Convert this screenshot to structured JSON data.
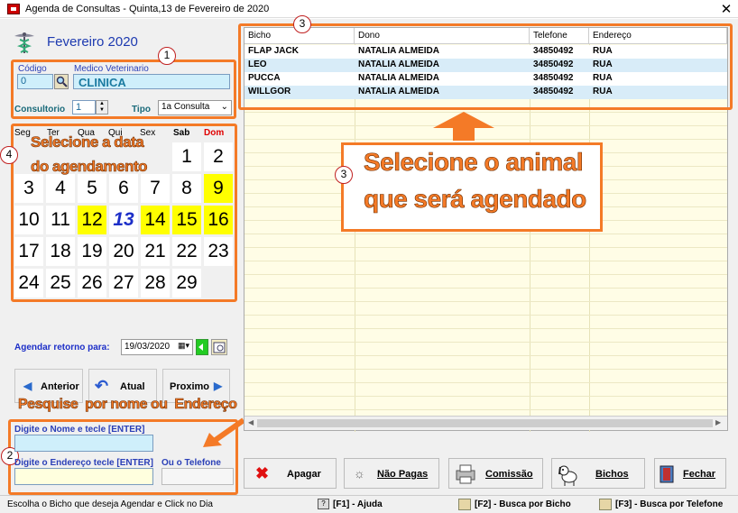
{
  "window": {
    "title": "Agenda de Consultas - Quinta,13 de Fevereiro de 2020",
    "close": "✕"
  },
  "calendar": {
    "month_title": "Fevereiro 2020",
    "weekdays": [
      "Seg",
      "Ter",
      "Qua",
      "Qui",
      "Sex",
      "Sab",
      "Dom"
    ],
    "weeks": [
      [
        "",
        "",
        "",
        "",
        "",
        "1",
        "2"
      ],
      [
        "3",
        "4",
        "5",
        "6",
        "7",
        "8",
        "9"
      ],
      [
        "10",
        "11",
        "12",
        "13",
        "14",
        "15",
        "16"
      ],
      [
        "17",
        "18",
        "19",
        "20",
        "21",
        "22",
        "23"
      ],
      [
        "24",
        "25",
        "26",
        "27",
        "28",
        "29",
        ""
      ]
    ],
    "highlighted": [
      "9",
      "12",
      "14",
      "15",
      "16"
    ],
    "today": "13",
    "colors": {
      "highlight": "#ffff00",
      "today": "#1d2fc8",
      "sunday": "#e00000"
    }
  },
  "form": {
    "codigo_label": "Código",
    "codigo_value": "0",
    "medico_label": "Medico Veterinario",
    "medico_value": "CLINICA",
    "consultorio_label": "Consultorio",
    "consultorio_value": "1",
    "tipo_label": "Tipo",
    "tipo_value": "1a Consulta",
    "retorno_label": "Agendar retorno para:",
    "retorno_value": "19/03/2020"
  },
  "nav": {
    "anterior": "Anterior",
    "atual": "Atual",
    "proximo": "Proximo"
  },
  "search": {
    "nome_label": "Digite o Nome e tecle [ENTER]",
    "endereco_label": "Digite o Endereço tecle [ENTER]",
    "telefone_label": "Ou o Telefone"
  },
  "annotations": {
    "n1": "1",
    "n2": "2",
    "n3": "3",
    "n4": "4",
    "select_date_1": "Selecione a data",
    "select_date_2": "do agendamento",
    "search_hint": "Pesquise  por nome ou  Endereço",
    "select_animal_1": "Selecione o animal",
    "select_animal_2": "que será agendado",
    "accent": "#f47a27"
  },
  "grid": {
    "columns": [
      "Bicho",
      "Dono",
      "Telefone",
      "Endereço"
    ],
    "rows": [
      [
        "FLAP JACK",
        "NATALIA ALMEIDA",
        "34850492",
        "RUA"
      ],
      [
        "LEO",
        "NATALIA ALMEIDA",
        "34850492",
        "RUA"
      ],
      [
        "PUCCA",
        "NATALIA ALMEIDA",
        "34850492",
        "RUA"
      ],
      [
        "WILLGOR",
        "NATALIA ALMEIDA",
        "34850492",
        "RUA"
      ]
    ]
  },
  "buttons": {
    "apagar": "Apagar",
    "nao_pagas": "Não Pagas",
    "comissao": "Comissão",
    "bichos": "Bichos",
    "fechar": "Fechar"
  },
  "status": {
    "message": "Escolha o Bicho que deseja Agendar e Click no Dia",
    "f1": "[F1] - Ajuda",
    "f2": "[F2] - Busca por Bicho",
    "f3": "[F3] - Busca por Telefone"
  }
}
